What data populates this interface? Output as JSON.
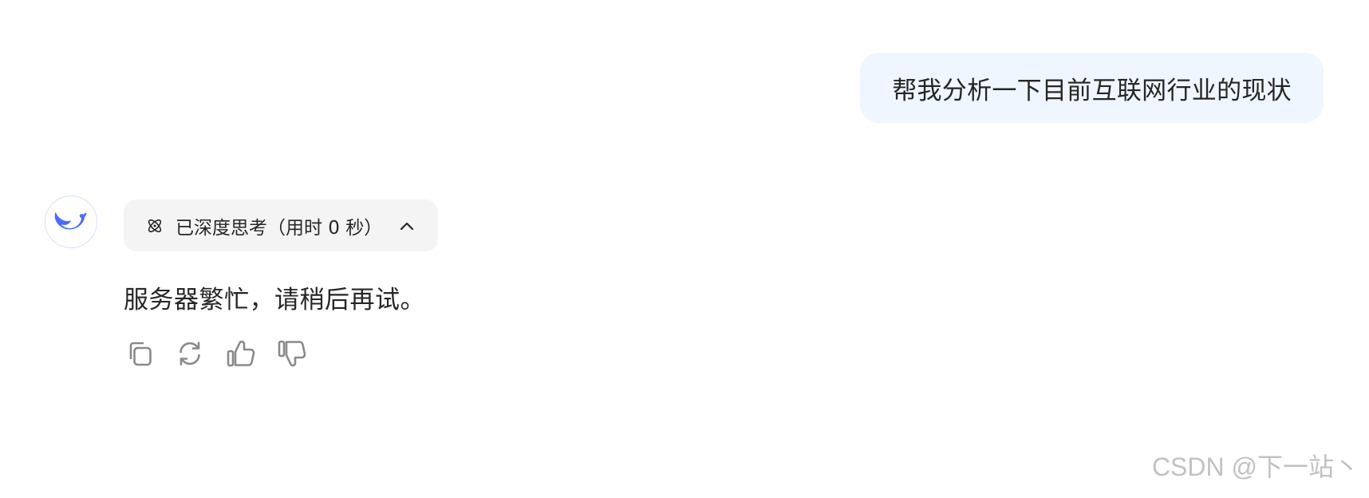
{
  "user_message": {
    "text": "帮我分析一下目前互联网行业的现状"
  },
  "assistant": {
    "avatar_icon": "deepseek-whale-logo",
    "think_label": "已深度思考（用时 0 秒）",
    "think_icon": "atom-icon",
    "think_toggle_icon": "chevron-up-icon",
    "answer_text": "服务器繁忙，请稍后再试。",
    "actions": [
      {
        "name": "copy-icon"
      },
      {
        "name": "regenerate-icon"
      },
      {
        "name": "thumbs-up-icon"
      },
      {
        "name": "thumbs-down-icon"
      }
    ]
  },
  "watermark": {
    "text": "CSDN @下一站丶"
  },
  "colors": {
    "user_bubble_bg": "#eff6ff",
    "think_pill_bg": "#f4f4f5",
    "brand_blue": "#4d6bfe",
    "icon_gray": "#8a8a8a",
    "text": "#262626",
    "watermark": "#c2c2c2"
  }
}
